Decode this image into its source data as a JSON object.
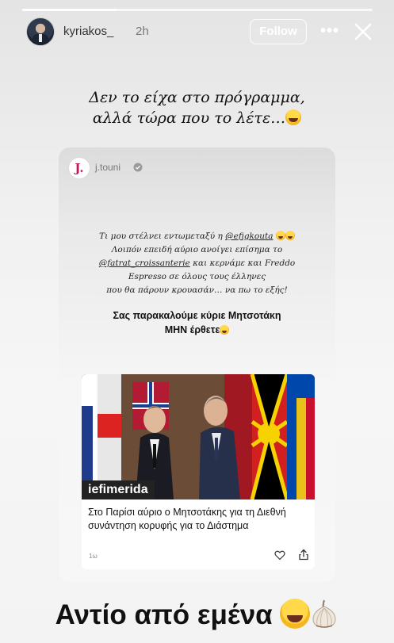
{
  "story": {
    "progress_fraction": 0.27,
    "username": "kyriakos_",
    "time": "2h",
    "follow_label": "Follow",
    "more_label": "•••",
    "caption_line1": "Δεν το είχα στο πρόγραμμα,",
    "caption_line2": "αλλά τώρα που το λέτε…",
    "bottom_caption": "Αντίο από εμένα"
  },
  "shared_post": {
    "avatar_letter": "J.",
    "username": "j.touni",
    "text_line1": "Τι μου στέλνει εντωμεταξύ η",
    "mention1": "@efigkouta",
    "text_line2": "Λοιπόν επειδή αύριο ανοίγει επίσημα το",
    "mention2": "@fatrat_croissanterie",
    "text_line3_rest": "και κερνάμε και Freddo",
    "text_line4": "Espresso σε όλους τους έλληνες",
    "text_line5": "που θα πάρουν κρουασάν… να πω το εξής!",
    "bold_line1": "Σας παρακαλούμε κύριε Μητσοτάκη",
    "bold_line2": "ΜΗΝ έρθετε"
  },
  "article": {
    "brand": "iefimerida",
    "title": "Στο Παρίσι αύριο ο Μητσοτάκης για τη Διεθνή συνάντηση κορυφής για το Διάστημα",
    "time": "1ω"
  },
  "icons": {
    "close": "close-icon",
    "more": "more-icon",
    "verified": "verified-icon",
    "heart": "heart-icon",
    "share": "share-icon",
    "laugh_emoji": "laughing-emoji",
    "garlic_emoji": "garlic-emoji"
  },
  "colors": {
    "brand_accent": "#c2185b",
    "badge_bg": "#222222"
  }
}
